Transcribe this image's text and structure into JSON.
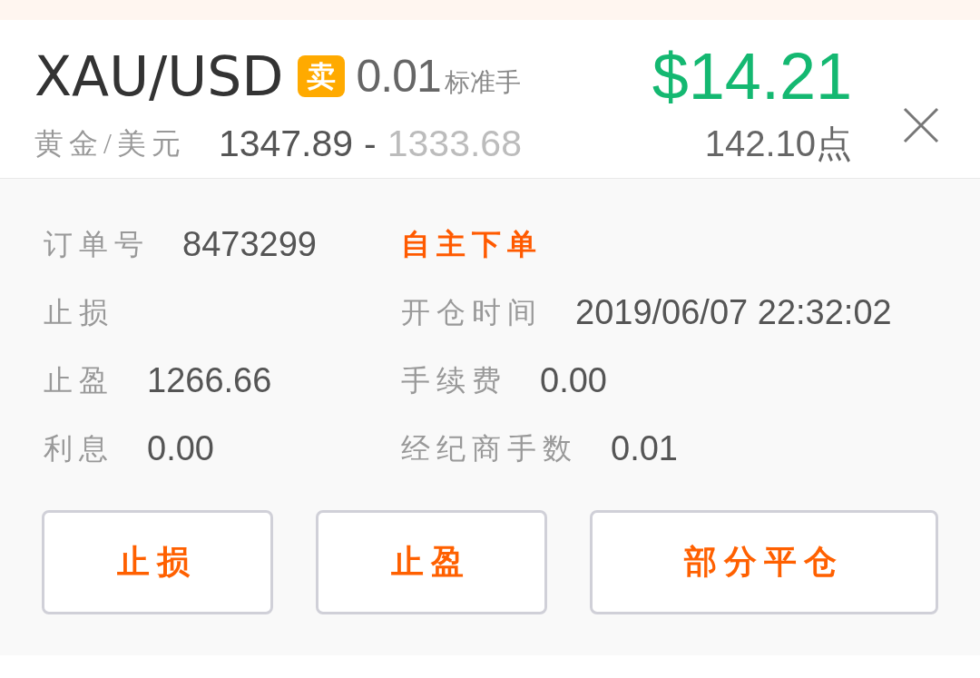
{
  "header": {
    "symbol": "XAU/USD",
    "side_badge": "卖",
    "lots": "0.01",
    "lots_unit": "标准手",
    "name": "黄金/美元",
    "open_price": "1347.89",
    "separator": "-",
    "current_price": "1333.68",
    "profit": "$14.21",
    "points": "142.10点"
  },
  "details": [
    {
      "kind": "field",
      "label": "订单号",
      "value": "8473299"
    },
    {
      "kind": "tag",
      "text": "自主下单"
    },
    {
      "kind": "field",
      "label": "止损"
    },
    {
      "kind": "field",
      "label": "开仓时间",
      "value": "2019/06/07 22:32:02"
    },
    {
      "kind": "field",
      "label": "止盈",
      "value": "1266.66"
    },
    {
      "kind": "field",
      "label": "手续费",
      "value": "0.00"
    },
    {
      "kind": "field",
      "label": "利息",
      "value": "0.00"
    },
    {
      "kind": "field",
      "label": "经纪商手数",
      "value": "0.01"
    }
  ],
  "actions": [
    {
      "label": "止损"
    },
    {
      "label": "止盈"
    },
    {
      "label": "部分平仓"
    }
  ]
}
